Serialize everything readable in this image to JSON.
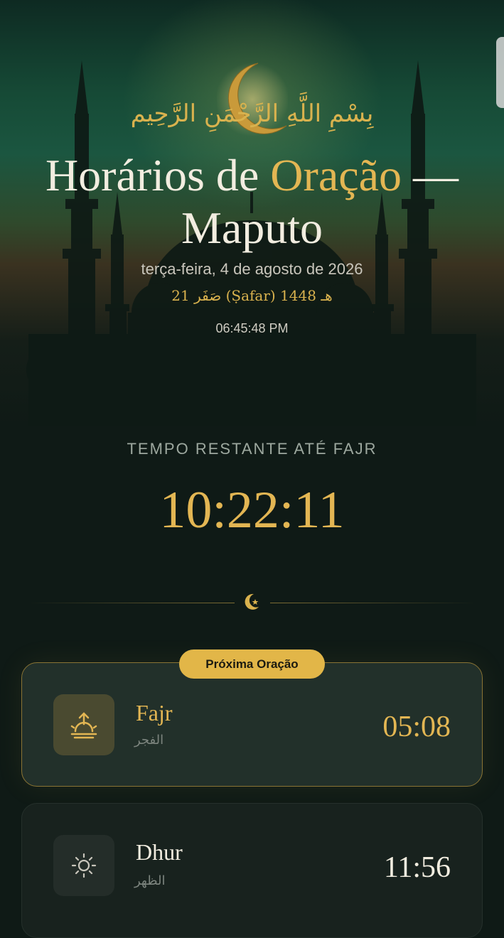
{
  "header": {
    "bismillah": "بِسْمِ اللَّهِ الرَّحْمَنِ الرَّحِيم",
    "title_prefix": "Horários de ",
    "title_accent": "Oração",
    "title_suffix": " — Maputo",
    "gregorian_date": "terça-feira, 4 de agosto de 2026",
    "hijri_date": "21 صَفَر (Ṣafar) 1448 هـ",
    "current_time": "06:45:48 PM"
  },
  "countdown": {
    "label": "TEMPO RESTANTE ATÉ FAJR",
    "value": "10:22:11"
  },
  "next_prayer_badge": "Próxima Oração",
  "prayers": [
    {
      "name": "Fajr",
      "arabic": "الفجر",
      "time": "05:08",
      "icon": "sunrise-icon",
      "active": true
    },
    {
      "name": "Dhur",
      "arabic": "الظهر",
      "time": "11:56",
      "icon": "sun-icon",
      "active": false
    }
  ],
  "colors": {
    "gold": "#e3b653",
    "badge": "#e2b648",
    "background": "#0f1a16",
    "active_card": "#22302a",
    "card": "#18221e"
  }
}
